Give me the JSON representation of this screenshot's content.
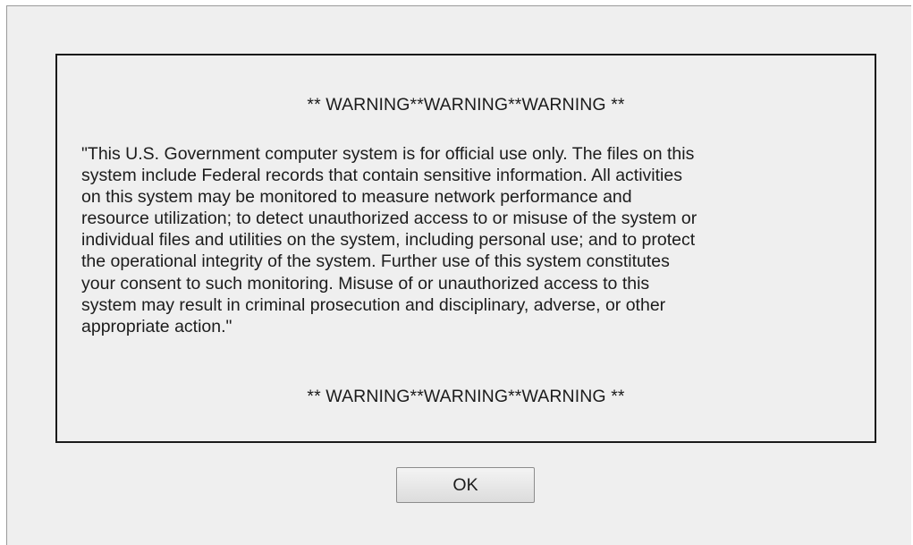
{
  "dialog": {
    "banner_top": "** WARNING**WARNING**WARNING **",
    "notice_text": "\"This U.S. Government computer system is for official use only. The files on this\nsystem include Federal records that contain sensitive information. All activities\non this system may be monitored to measure network performance and\nresource utilization; to detect unauthorized access to or misuse of the system or\nindividual files and utilities on the system, including personal use; and to protect\nthe operational integrity of the system. Further use of this system constitutes\nyour consent to such monitoring. Misuse of or unauthorized access to this\nsystem may result in criminal prosecution and disciplinary, adverse, or other\nappropriate action.\"",
    "banner_bottom": "** WARNING**WARNING**WARNING **",
    "ok_label": "OK"
  }
}
